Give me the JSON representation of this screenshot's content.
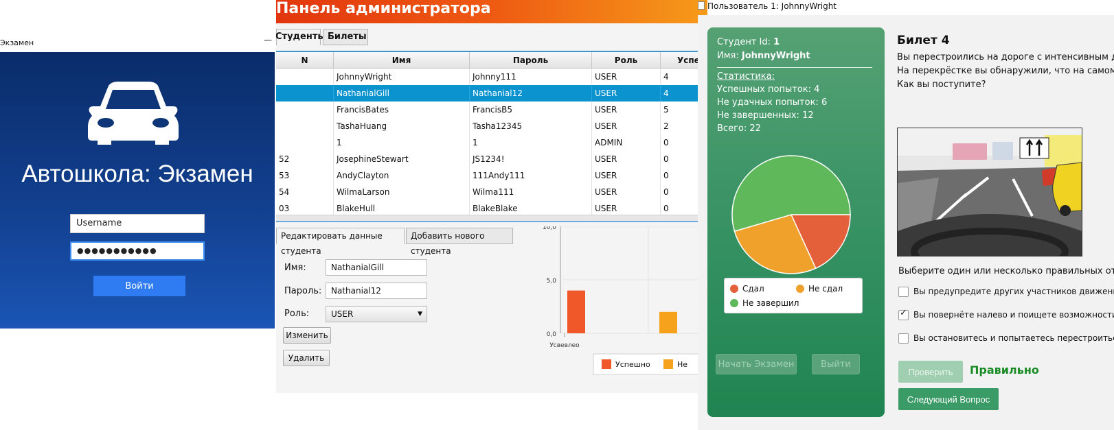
{
  "login": {
    "window_title": "Экзамен",
    "minimize_glyph": "—",
    "title": "Автошкола: Экзамен",
    "username_value": "Username",
    "password_value": "●●●●●●●●●●●",
    "login_button": "Войти",
    "icon": "car-icon",
    "background_colors": [
      "#0a2d6a",
      "#1a55b5"
    ]
  },
  "admin": {
    "title": "Панель администратора",
    "header_colors": [
      "#e2360e",
      "#f69a1a"
    ],
    "tabs": [
      "Студенты",
      "Билеты"
    ],
    "table": {
      "columns": [
        "N",
        "Имя",
        "Пароль",
        "Роль",
        "Успеш"
      ],
      "rows": [
        {
          "n": "",
          "name": "JohnnyWright",
          "password": "Johnny111",
          "role": "USER",
          "success": "4"
        },
        {
          "n": "",
          "name": "NathanialGill",
          "password": "Nathanial12",
          "role": "USER",
          "success": "4"
        },
        {
          "n": "",
          "name": "FrancisBates",
          "password": "FrancisB5",
          "role": "USER",
          "success": "5"
        },
        {
          "n": "",
          "name": "TashaHuang",
          "password": "Tasha12345",
          "role": "USER",
          "success": "2"
        },
        {
          "n": "",
          "name": "1",
          "password": "1",
          "role": "ADMIN",
          "success": "0"
        },
        {
          "n": "52",
          "name": "JosephineStewart",
          "password": "JS1234!",
          "role": "USER",
          "success": "0"
        },
        {
          "n": "53",
          "name": "AndyClayton",
          "password": "111Andy111",
          "role": "USER",
          "success": "0"
        },
        {
          "n": "54",
          "name": "WilmaLarson",
          "password": "Wilma111",
          "role": "USER",
          "success": "0"
        },
        {
          "n": "03",
          "name": "BlakeHull",
          "password": "BlakeBlake",
          "role": "USER",
          "success": "0"
        }
      ],
      "selected_row": 1,
      "selection_color": "#0a93cf"
    },
    "edit_tabs": [
      "Редактировать данные студента",
      "Добавить нового студента"
    ],
    "form": {
      "name_label": "Имя:",
      "name_value": "NathanialGill",
      "password_label": "Пароль:",
      "password_value": "Nathanial12",
      "role_label": "Роль:",
      "role_value": "USER",
      "change_button": "Изменить",
      "delete_button": "Удалить"
    }
  },
  "chart_data": {
    "type": "bar",
    "categories": [
      "Усвевлео"
    ],
    "series": [
      {
        "name": "Успешно",
        "values": [
          4
        ],
        "color": "#f0582a"
      },
      {
        "name": "Не",
        "values": [
          2
        ],
        "color": "#f6a21d"
      }
    ],
    "ylim": [
      0,
      10
    ],
    "ytick_labels": [
      "0,0",
      "5,0",
      "10,0"
    ],
    "grid": true,
    "legend": "bottom"
  },
  "user": {
    "window_title": "Пользователь 1: JohnnyWright",
    "stats": {
      "id_label": "Студент Id:",
      "id_value": "1",
      "name_label": "Имя:",
      "name_value": "JohnnyWright",
      "section": "Статистика:",
      "success_label": "Успешных попыток:",
      "success_value": "4",
      "failed_label": "Не удачных попыток:",
      "failed_value": "6",
      "unfinished_label": "Не завершенных:",
      "unfinished_value": "12",
      "total_label": "Всего:",
      "total_value": "22"
    },
    "pie": {
      "type": "pie",
      "slices": [
        {
          "label": "Сдал",
          "value": 4,
          "color": "#e4603a"
        },
        {
          "label": "Не сдал",
          "value": 6,
          "color": "#f0a12c"
        },
        {
          "label": "Не завершил",
          "value": 12,
          "color": "#5fb85a"
        }
      ]
    },
    "start_button": "Начать Экзамен",
    "exit_button": "Выйти",
    "ticket_title": "Билет 4",
    "question": [
      "Вы перестроились на дороге с интенсивным дв",
      "На перекрёстке вы обнаружили, что на самом д",
      "Как вы поступите?"
    ],
    "choose_prompt": "Выберите один или несколько правильных отве",
    "options": [
      {
        "text": "Вы предупредите других участников движения и по",
        "checked": false
      },
      {
        "text": "Вы повернёте налево и поищете возможности для",
        "checked": true
      },
      {
        "text": "Вы остановитесь и попытаетесь перестроиться задн",
        "checked": false
      }
    ],
    "check_button": "Проверить",
    "result": "Правильно",
    "next_button": "Следующий Вопрос",
    "accent_green": "#198c24"
  }
}
